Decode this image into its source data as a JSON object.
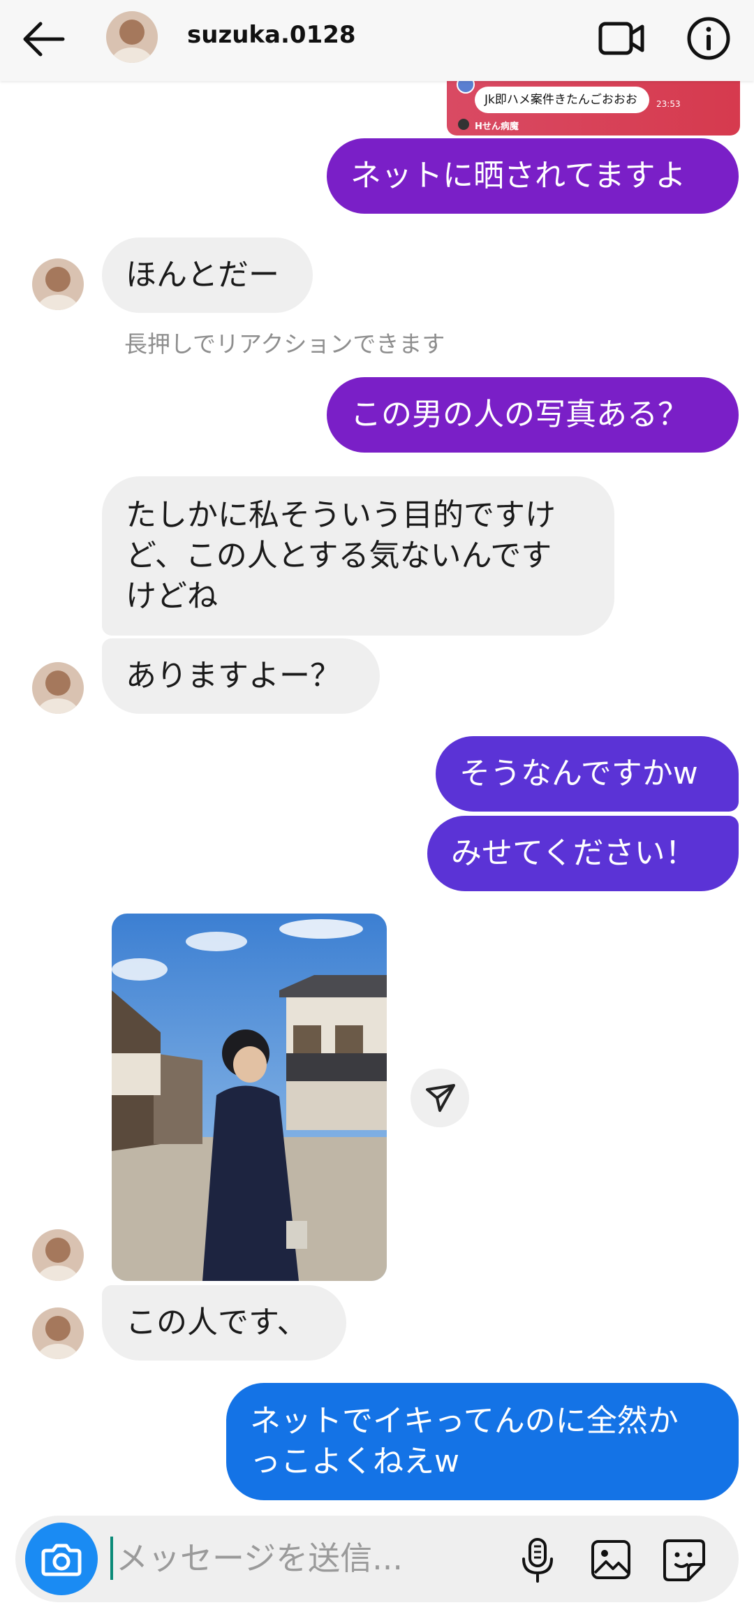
{
  "header": {
    "username": "suzuka.0128"
  },
  "shared_post": {
    "bubble_text": "Jk即ハメ案件きたんごおおお",
    "time": "23:53",
    "name": "Hせん病魔"
  },
  "messages": [
    {
      "side": "sent",
      "text": "ネットに晒されてますよ"
    },
    {
      "side": "received",
      "text": "ほんとだー"
    },
    {
      "side": "hint",
      "text": "長押しでリアクションできます"
    },
    {
      "side": "sent",
      "text": "この男の人の写真ある？"
    },
    {
      "side": "received",
      "lines": [
        "たしかに私そういう目的ですけ",
        "ど、この人とする気ないんです",
        "けどね"
      ]
    },
    {
      "side": "received",
      "text": "ありますよー？"
    },
    {
      "side": "sent",
      "text": "そうなんですかw"
    },
    {
      "side": "sent",
      "text": "みせてください！"
    },
    {
      "side": "received",
      "text": "この人です、"
    },
    {
      "side": "sent",
      "lines": [
        "ネットでイキってんのに全然か",
        "っこよくねえw"
      ]
    }
  ],
  "composer": {
    "placeholder": "メッセージを送信..."
  },
  "colors": {
    "purple": "#7a1fc7",
    "violet": "#5b33d6",
    "blue": "#1473e6",
    "received_bg": "#efefef",
    "camera": "#1a8bf3"
  }
}
